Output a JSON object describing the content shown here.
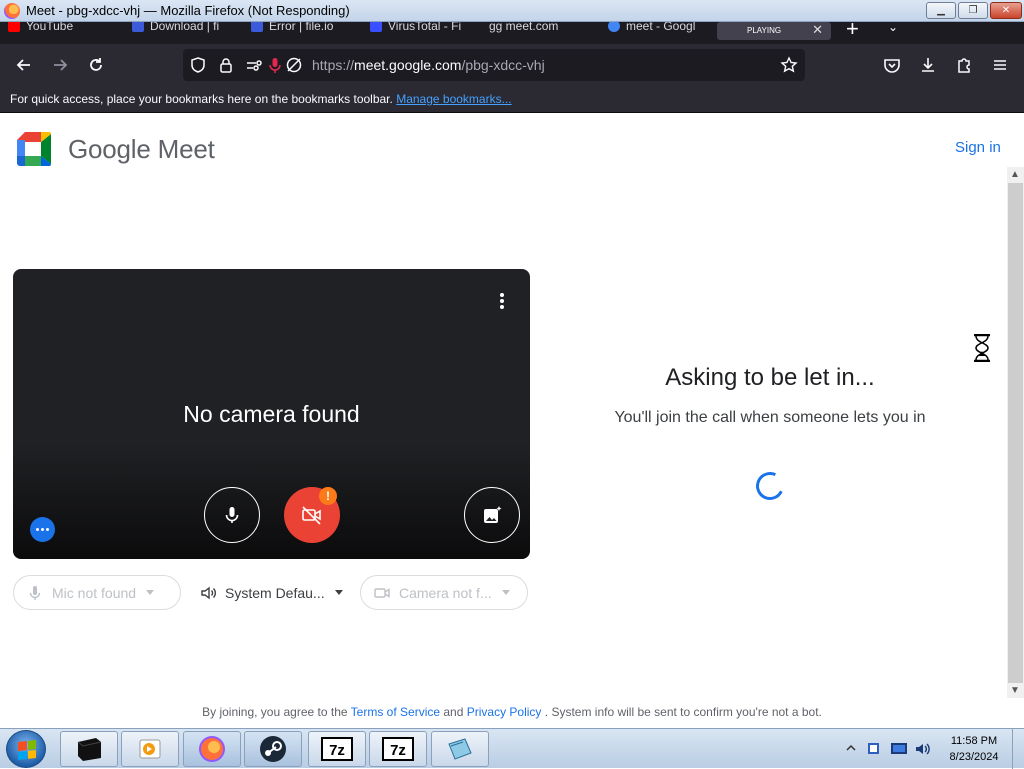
{
  "window": {
    "title": "Meet - pbg-xdcc-vhj — Mozilla Firefox (Not Responding)"
  },
  "tabs": [
    {
      "label": "YouTube",
      "color": "#ff0000"
    },
    {
      "label": "Download | fi",
      "color": "#3b5bdb"
    },
    {
      "label": "Error | file.io",
      "color": "#3b5bdb"
    },
    {
      "label": "VirusTotal - Fi",
      "color": "#394eff"
    },
    {
      "label": "gg meet.com",
      "color": "#ffffff"
    },
    {
      "label": "meet - Googl",
      "color": "#4285f4"
    }
  ],
  "playing_tab": {
    "label": "PLAYING"
  },
  "url": {
    "scheme": "https://",
    "domain": "meet.google.com",
    "path": "/pbg-xdcc-vhj"
  },
  "bookmarks_bar": {
    "message": "For quick access, place your bookmarks here on the bookmarks toolbar.",
    "link": "Manage bookmarks..."
  },
  "meet": {
    "brand": "Google Meet",
    "sign_in": "Sign in",
    "no_camera": "No camera found",
    "warning_badge": "!",
    "devices": {
      "mic": "Mic not found",
      "speaker": "System Defau...",
      "camera": "Camera not f..."
    },
    "ask_title": "Asking to be let in...",
    "ask_subtitle": "You'll join the call when someone lets you in",
    "footer": {
      "prefix": "By joining, you agree to the",
      "terms": "Terms of Service",
      "and": "and",
      "privacy": "Privacy Policy",
      "suffix": ". System info will be sent to confirm you're not a bot."
    }
  },
  "taskbar": {
    "apps": [
      "desktop-app",
      "media-player",
      "firefox",
      "steam",
      "7zip",
      "7zip",
      "notebook-app"
    ],
    "clock_time": "11:58 PM",
    "clock_date": "8/23/2024"
  },
  "colors": {
    "accent": "#1a73e8",
    "red": "#ea4335",
    "warning": "#fa7b17"
  }
}
